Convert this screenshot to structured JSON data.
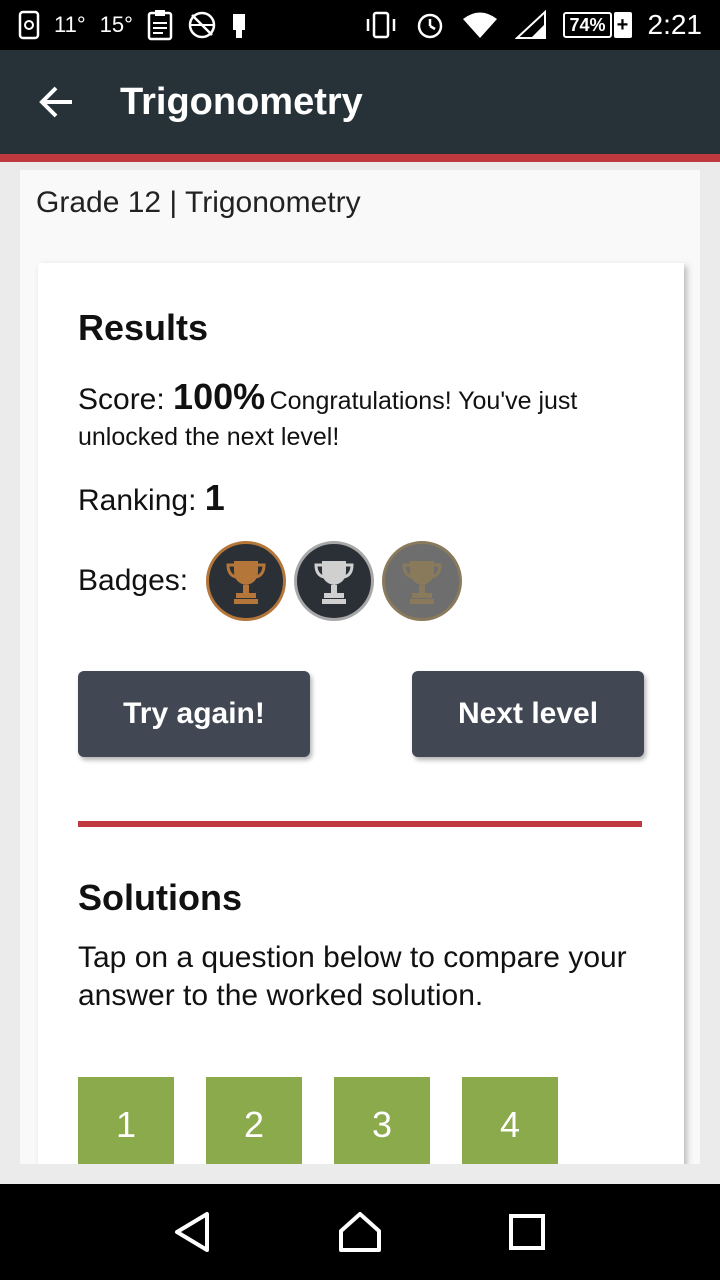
{
  "status_bar": {
    "left_texts": [
      "11°",
      "15°"
    ],
    "battery": "74%",
    "time": "2:21"
  },
  "app_bar": {
    "title": "Trigonometry",
    "back_icon": "arrow-back-icon"
  },
  "breadcrumb": "Grade 12 | Trigonometry",
  "results": {
    "heading": "Results",
    "score_label": "Score: ",
    "score_value": "100%",
    "score_message": "Congratulations! You've just unlocked the next level!",
    "ranking_label": "Ranking: ",
    "ranking_value": "1",
    "badges_label": "Badges:",
    "badges": [
      {
        "name": "bronze-trophy-icon",
        "color": "#b5763a"
      },
      {
        "name": "silver-trophy-icon",
        "color": "#d0d0d0"
      },
      {
        "name": "gold-trophy-icon",
        "color": "#8a7a5c"
      }
    ],
    "try_again_label": "Try again!",
    "next_level_label": "Next level"
  },
  "solutions": {
    "heading": "Solutions",
    "description": "Tap on a question below to compare your answer to the worked solution.",
    "questions": [
      "1",
      "2",
      "3",
      "4"
    ]
  },
  "colors": {
    "accent": "#c0393f",
    "app_bar": "#263238",
    "button": "#414853",
    "question_tile": "#8aaa4c"
  }
}
